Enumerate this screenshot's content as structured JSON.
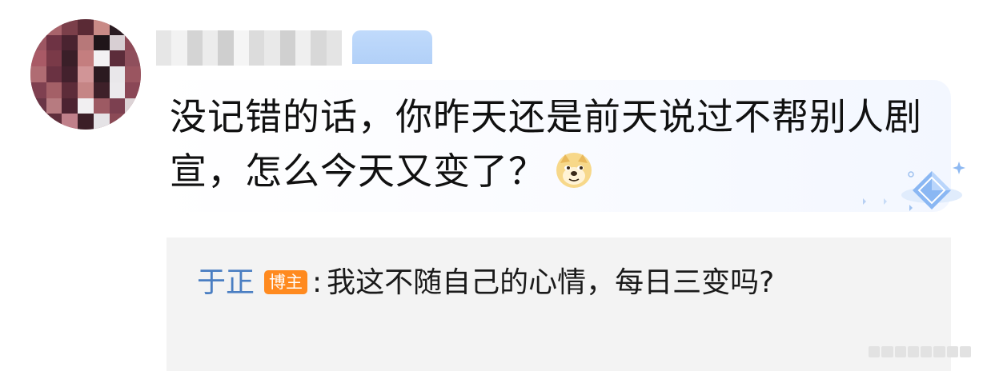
{
  "comment": {
    "author_name": "",
    "text": "没记错的话，你昨天还是前天说过不帮别人剧宣，怎么今天又变了？",
    "emoji_icon": "doge-emoji-icon"
  },
  "reply": {
    "author": "于正",
    "owner_badge": "博主",
    "colon": ":",
    "text": "我这不随自己的心情，每日三变吗?"
  },
  "colors": {
    "reply_author": "#4a7ec2",
    "owner_badge_bg": "#ff8a1f",
    "reply_bg": "#f3f3f3",
    "badge_blur": "#aacbf7"
  }
}
